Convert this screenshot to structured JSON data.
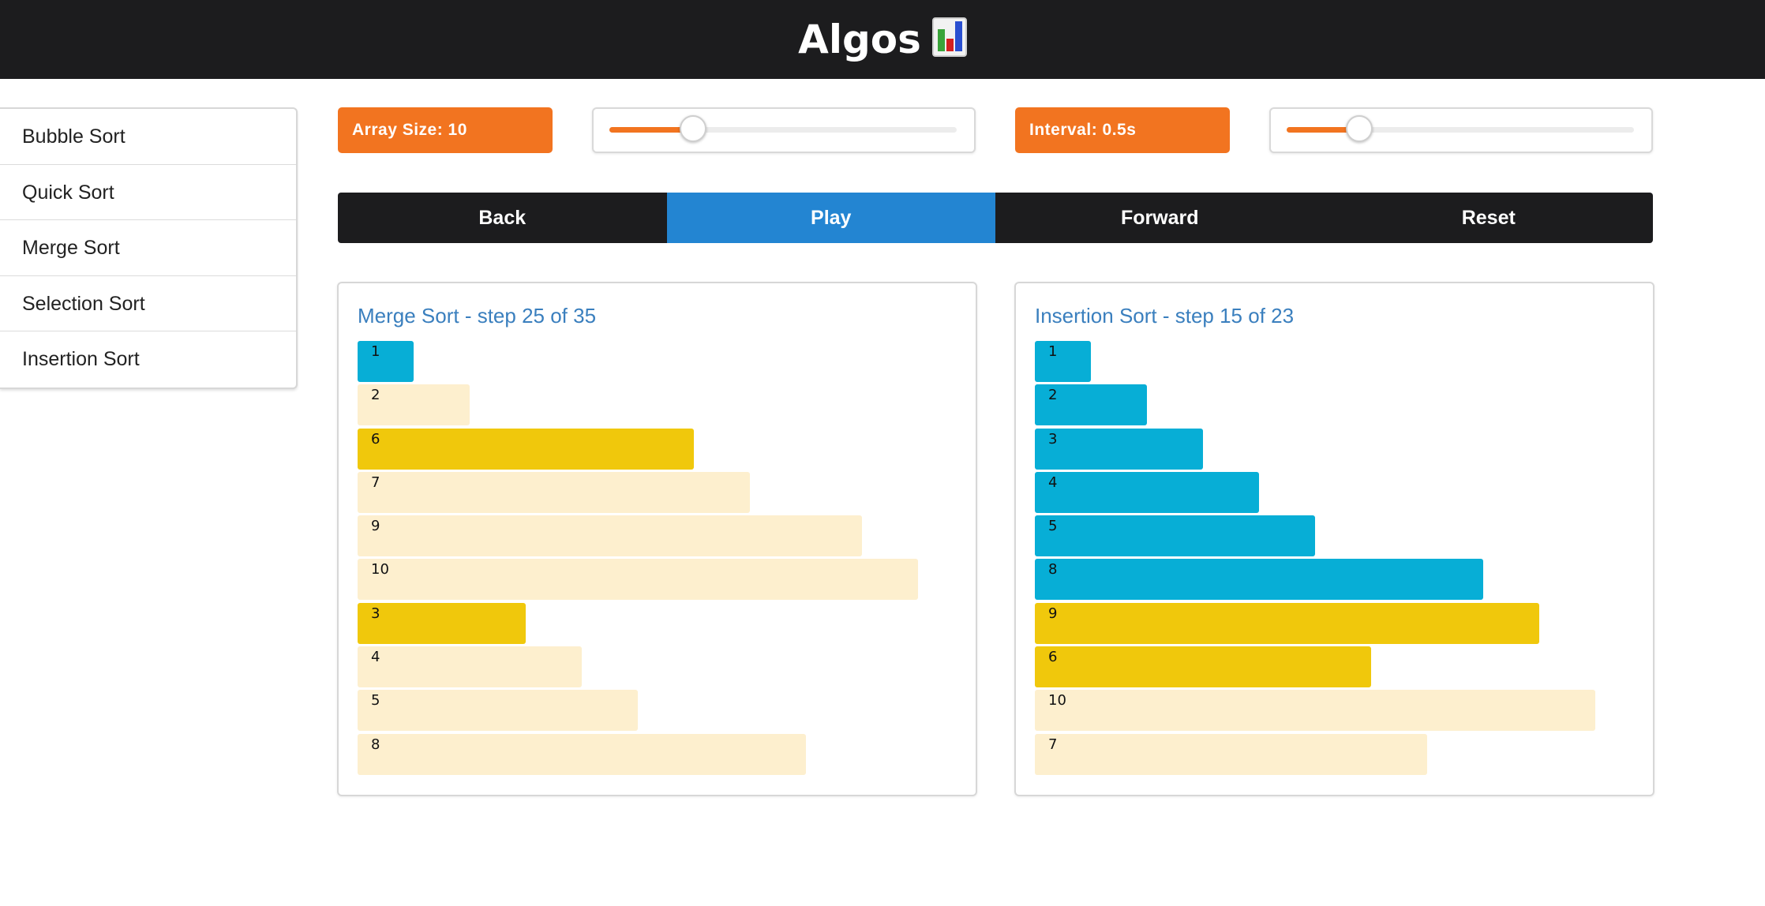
{
  "app": {
    "title": "Algos"
  },
  "colors": {
    "header_bg": "#1c1c1e",
    "accent_orange": "#f27420",
    "play_blue": "#2385d2",
    "sorted": "#07aed6",
    "active": "#f0c80c",
    "unsorted": "#fdefce",
    "panel_title": "#3a7fbe"
  },
  "sidebar": {
    "items": [
      {
        "label": "Bubble Sort"
      },
      {
        "label": "Quick Sort"
      },
      {
        "label": "Merge Sort"
      },
      {
        "label": "Selection Sort"
      },
      {
        "label": "Insertion Sort"
      }
    ]
  },
  "settings": {
    "array_size_label": "Array Size: 10",
    "array_size_slider_fraction": 0.24,
    "interval_label": "Interval: 0.5s",
    "interval_slider_fraction": 0.21
  },
  "controls": {
    "back": "Back",
    "play": "Play",
    "forward": "Forward",
    "reset": "Reset",
    "active": "play"
  },
  "panels": {
    "left": {
      "title": "Merge Sort - step 25 of 35",
      "max_value": 10,
      "bars": [
        {
          "value": 1,
          "label": "1",
          "state": "sorted"
        },
        {
          "value": 2,
          "label": "2",
          "state": "unsorted"
        },
        {
          "value": 6,
          "label": "6",
          "state": "active"
        },
        {
          "value": 7,
          "label": "7",
          "state": "unsorted"
        },
        {
          "value": 9,
          "label": "9",
          "state": "unsorted"
        },
        {
          "value": 10,
          "label": "10",
          "state": "unsorted"
        },
        {
          "value": 3,
          "label": "3",
          "state": "active"
        },
        {
          "value": 4,
          "label": "4",
          "state": "unsorted"
        },
        {
          "value": 5,
          "label": "5",
          "state": "unsorted"
        },
        {
          "value": 8,
          "label": "8",
          "state": "unsorted"
        }
      ]
    },
    "right": {
      "title": "Insertion Sort - step 15 of 23",
      "max_value": 10,
      "bars": [
        {
          "value": 1,
          "label": "1",
          "state": "sorted"
        },
        {
          "value": 2,
          "label": "2",
          "state": "sorted"
        },
        {
          "value": 3,
          "label": "3",
          "state": "sorted"
        },
        {
          "value": 4,
          "label": "4",
          "state": "sorted"
        },
        {
          "value": 5,
          "label": "5",
          "state": "sorted"
        },
        {
          "value": 8,
          "label": "8",
          "state": "sorted"
        },
        {
          "value": 9,
          "label": "9",
          "state": "active"
        },
        {
          "value": 6,
          "label": "6",
          "state": "active"
        },
        {
          "value": 10,
          "label": "10",
          "state": "unsorted"
        },
        {
          "value": 7,
          "label": "7",
          "state": "unsorted"
        }
      ]
    }
  }
}
